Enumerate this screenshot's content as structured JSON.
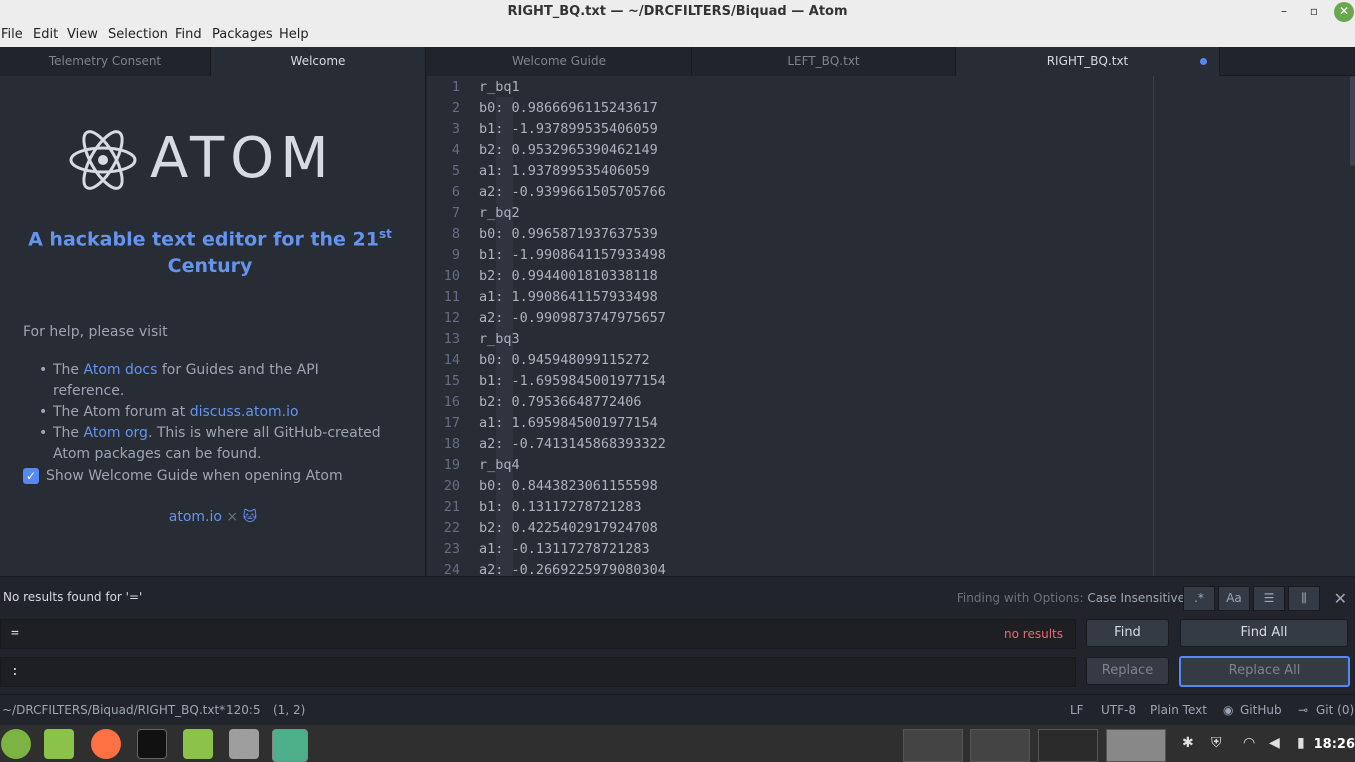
{
  "window": {
    "title": "RIGHT_BQ.txt — ~/DRCFILTERS/Biquad — Atom",
    "minimize": "–",
    "maximize": "▫",
    "close": "✕"
  },
  "menu": [
    "File",
    "Edit",
    "View",
    "Selection",
    "Find",
    "Packages",
    "Help"
  ],
  "tabs": [
    {
      "label": "Telemetry Consent"
    },
    {
      "label": "Welcome"
    },
    {
      "label": "Welcome Guide"
    },
    {
      "label": "LEFT_BQ.txt"
    },
    {
      "label": "RIGHT_BQ.txt"
    }
  ],
  "welcome": {
    "logo_text": "ATOM",
    "tagline_main": "A hackable text editor for the 21",
    "tagline_sup": "st",
    "tagline_end": "Century",
    "help_title": "For help, please visit",
    "help": {
      "item1_pre": "The ",
      "item1_link": "Atom docs",
      "item1_post": " for Guides and the API reference.",
      "item2_pre": "The Atom forum at ",
      "item2_link": "discuss.atom.io",
      "item3_pre": "The ",
      "item3_link": "Atom org",
      "item3_post": ". This is where all GitHub-created Atom packages can be found."
    },
    "checkbox_label": "Show Welcome Guide when opening Atom",
    "footer_link": "atom.io",
    "footer_sep": " × "
  },
  "editor": {
    "lines": [
      "r_bq1",
      "b0: 0.9866696115243617",
      "b1: -1.937899535406059",
      "b2: 0.9532965390462149",
      "a1: 1.937899535406059",
      "a2: -0.9399661505705766",
      "r_bq2",
      "b0: 0.9965871937637539",
      "b1: -1.9908641157933498",
      "b2: 0.9944001810338118",
      "a1: 1.9908641157933498",
      "a2: -0.9909873747975657",
      "r_bq3",
      "b0: 0.945948099115272",
      "b1: -1.6959845001977154",
      "b2: 0.79536648772406",
      "a1: 1.6959845001977154",
      "a2: -0.7413145868393322",
      "r_bq4",
      "b0: 0.8443823061155598",
      "b1: 0.13117278721283",
      "b2: 0.4225402917924708",
      "a1: -0.13117278721283",
      "a2: -0.2669225979080304"
    ]
  },
  "find": {
    "message": "No results found for '='",
    "options_label": "Finding with Options:",
    "options_value": "Case Insensitive",
    "opt_regex": ".*",
    "opt_case": "Aa",
    "opt_selection": "☰",
    "opt_word": "⫼",
    "find_value": "=",
    "no_results": "no results",
    "replace_value": ":",
    "find_button": "Find",
    "find_all_button": "Find All",
    "replace_button": "Replace",
    "replace_all_button": "Replace All"
  },
  "status": {
    "path": "~/DRCFILTERS/Biquad/RIGHT_BQ.txt*",
    "cursor": "120:5",
    "selection": "(1, 2)",
    "line_ending": "LF",
    "encoding": "UTF-8",
    "grammar": "Plain Text",
    "github": "GitHub",
    "git": "Git (0)"
  },
  "taskbar": {
    "clock": "18:26"
  }
}
